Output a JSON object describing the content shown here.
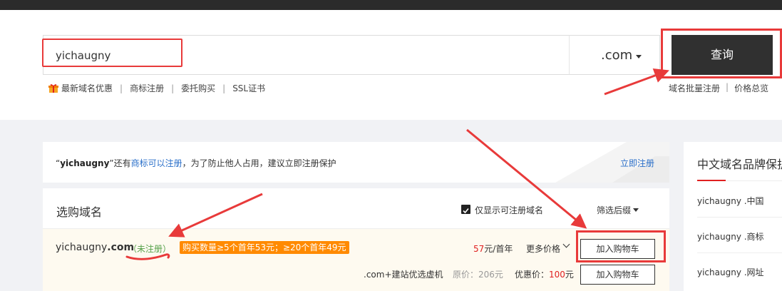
{
  "search": {
    "value": "yichaugny"
  },
  "tld_select": {
    "value": ".com"
  },
  "query_button": {
    "label": "查询"
  },
  "quick_links": [
    "最新域名优惠",
    "商标注册",
    "委托购买",
    "SSL证书"
  ],
  "right_links": [
    "域名批量注册",
    "价格总览"
  ],
  "notice": {
    "open_quote": "“",
    "domain": "yichaugny",
    "close_quote": "”还有",
    "highlight": "商标可以注册",
    "rest": "，为了防止他人占用，建议立即注册保护",
    "action": "立即注册"
  },
  "list": {
    "title": "选购域名",
    "checkbox_label": "仅显示可注册域名",
    "filter_label": "筛选后缀"
  },
  "row": {
    "domain_base": "yichaugny",
    "domain_tld": ".com",
    "status": "（未注册）",
    "promo": "购买数量≥5个首年53元；≥20个首年49元",
    "price_num": "57",
    "price_unit": "元/首年",
    "more_prices": "更多价格",
    "add_cart": "加入购物车",
    "bundle": ".com+建站优选虚机",
    "original_price": "原价：206元",
    "discount_label": "优惠价：",
    "discount_num": "100",
    "discount_unit": "元",
    "add_cart_2": "加入购物车"
  },
  "sidebar": {
    "title": "中文域名品牌保护",
    "items": [
      "yichaugny .中国",
      "yichaugny .商标",
      "yichaugny .网址"
    ]
  },
  "colors": {
    "highlight_red": "#e83a3a",
    "accent_blue": "#2a6fc9",
    "promo_orange": "#ff8a00",
    "status_green": "#56a14a"
  }
}
